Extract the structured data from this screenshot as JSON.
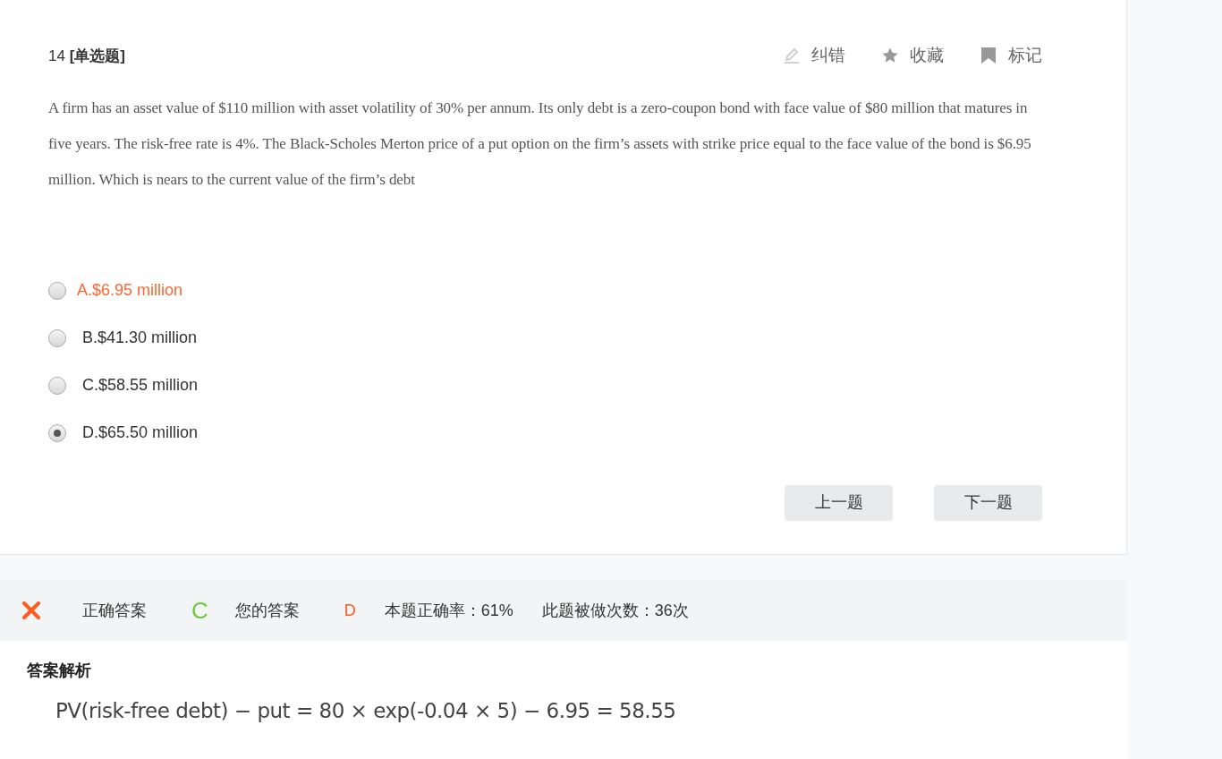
{
  "question": {
    "header": "14 **[单选题]**",
    "actions": [
      {
        "kind": "edit",
        "label": "纠错"
      },
      {
        "kind": "star",
        "label": "收藏"
      },
      {
        "kind": "bookmark",
        "label": "标记"
      }
    ],
    "text": "A firm has an asset value of $110 million with asset volatility of 30% per annum. Its only debt is a zero-coupon bond with face value of $80 million that matures in five years. The risk-free rate is 4%. The Black-Scholes Merton price of a put option on the firm’s assets with strike price equal to the face value of the bond is $6.95 million. Which is nears to the current value of the firm’s debt",
    "options": [
      {
        "label": "A.$6.95 million",
        "selected": false,
        "highlighted": true
      },
      {
        "label": "B.$41.30 million",
        "selected": false,
        "highlighted": false
      },
      {
        "label": "C.$58.55 million",
        "selected": false,
        "highlighted": false
      },
      {
        "label": "D.$65.50 million",
        "selected": true,
        "highlighted": false
      }
    ],
    "nav_buttons": [
      "上一题",
      "下一题"
    ]
  },
  "result": {
    "correct": false,
    "correct_label": "正确答案",
    "correct_answer": "C",
    "your_label": "您的答案",
    "your_answer": "D",
    "accuracy": "本题正确率：61%",
    "attempts": "此题被做次数：36次"
  },
  "analysis": {
    "title": "答案解析",
    "formula": "PV(risk-free debt) − put = 80 × exp(-0.04 × 5) − 6.95 = 58.55"
  }
}
